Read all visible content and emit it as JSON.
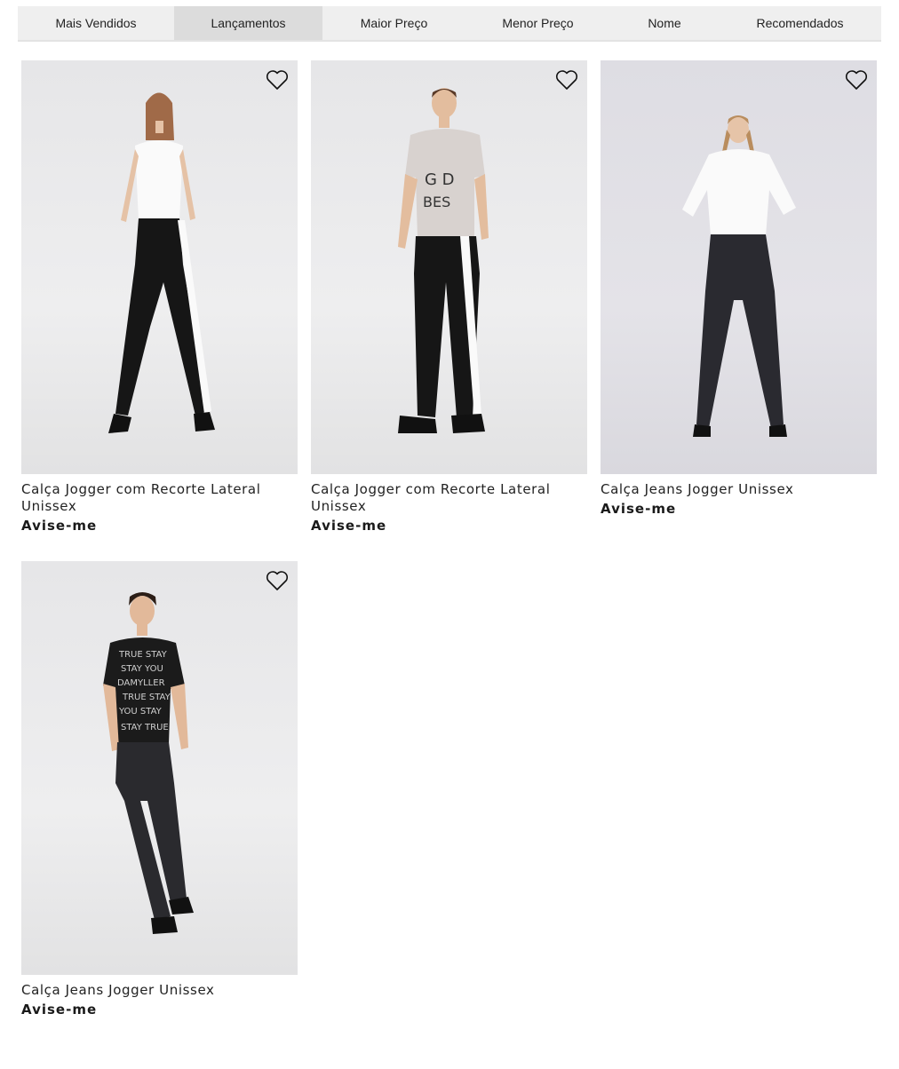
{
  "sort": {
    "tabs": [
      {
        "label": "Mais Vendidos",
        "active": false
      },
      {
        "label": "Lançamentos",
        "active": true
      },
      {
        "label": "Maior Preço",
        "active": false
      },
      {
        "label": "Menor Preço",
        "active": false
      },
      {
        "label": "Nome",
        "active": false
      },
      {
        "label": "Recomendados",
        "active": false
      }
    ]
  },
  "products": [
    {
      "name": "Calça Jogger com Recorte Lateral Unissex",
      "action": "Avise-me",
      "favorite_icon": "heart-outline-icon"
    },
    {
      "name": "Calça Jogger com Recorte Lateral Unissex",
      "action": "Avise-me",
      "favorite_icon": "heart-outline-icon"
    },
    {
      "name": "Calça Jeans Jogger Unissex",
      "action": "Avise-me",
      "favorite_icon": "heart-outline-icon"
    },
    {
      "name": "Calça Jeans Jogger Unissex",
      "action": "Avise-me",
      "favorite_icon": "heart-outline-icon"
    }
  ],
  "colors": {
    "tab_bg": "#efefef",
    "tab_active_bg": "#dcdcdc",
    "text": "#222222"
  }
}
